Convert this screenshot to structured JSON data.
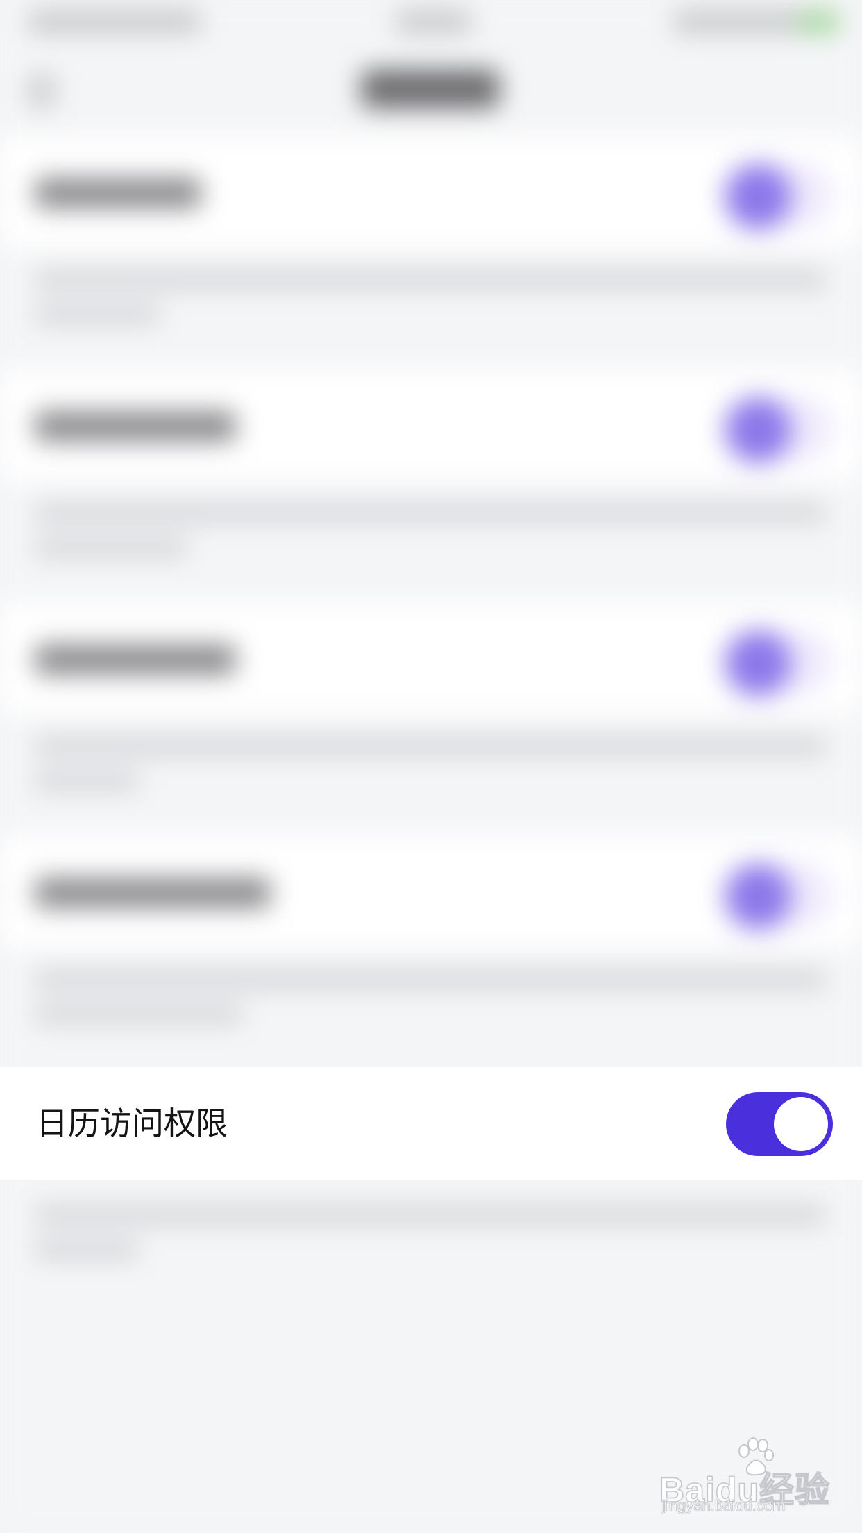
{
  "screen": {
    "background": "#f4f5f7"
  },
  "permission_row": {
    "label": "日历访问权限",
    "toggle_state": "on",
    "toggle_color": "#4a2fdd",
    "knob_color": "#ffffff"
  },
  "watermark": {
    "logo_text": "Baidu经验",
    "url": "jingyan.baidu.com"
  }
}
